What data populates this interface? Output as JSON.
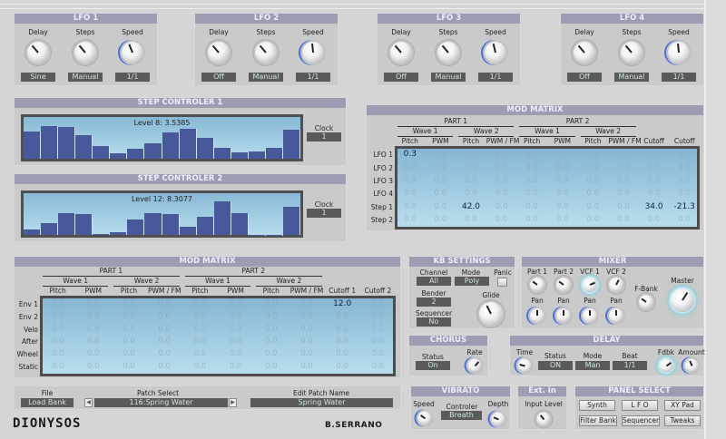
{
  "lfos": [
    {
      "title": "LFO 1",
      "knobs": [
        {
          "label": "Delay",
          "value": 0.35
        },
        {
          "label": "Steps",
          "value": 0.35
        },
        {
          "label": "Speed",
          "value": 0.42,
          "active": true
        }
      ],
      "values": [
        "Sine",
        "Manual",
        "1/1"
      ]
    },
    {
      "title": "LFO 2",
      "knobs": [
        {
          "label": "Delay",
          "value": 0.35
        },
        {
          "label": "Steps",
          "value": 0.35
        },
        {
          "label": "Speed",
          "value": 0.48,
          "active": true
        }
      ],
      "values": [
        "Off",
        "Manual",
        "1/1"
      ]
    },
    {
      "title": "LFO 3",
      "knobs": [
        {
          "label": "Delay",
          "value": 0.35
        },
        {
          "label": "Steps",
          "value": 0.35
        },
        {
          "label": "Speed",
          "value": 0.45,
          "active": true
        }
      ],
      "values": [
        "Off",
        "Manual",
        "1/1"
      ]
    },
    {
      "title": "LFO 4",
      "knobs": [
        {
          "label": "Delay",
          "value": 0.35
        },
        {
          "label": "Steps",
          "value": 0.35
        },
        {
          "label": "Speed",
          "value": 0.48,
          "active": true
        }
      ],
      "values": [
        "Off",
        "Manual",
        "1/1"
      ]
    }
  ],
  "step_controllers": [
    {
      "title": "STEP CONTROLER 1",
      "readout": "Level 8: 3.5385",
      "clock_label": "Clock",
      "clock_value": "1",
      "levels": [
        0.66,
        0.79,
        0.76,
        0.57,
        0.3,
        0.14,
        0.25,
        0.38,
        0.63,
        0.72,
        0.51,
        0.26,
        0.16,
        0.18,
        0.26,
        0.7
      ]
    },
    {
      "title": "STEP CONTROLER 2",
      "readout": "Level 12: 8.3077",
      "clock_label": "Clock",
      "clock_value": "1",
      "levels": [
        0.13,
        0.29,
        0.53,
        0.49,
        0.02,
        0.07,
        0.36,
        0.53,
        0.51,
        0.19,
        0.43,
        0.8,
        0.52,
        0.01,
        0.01,
        0.67
      ]
    }
  ],
  "mod_matrix_lfo": {
    "title": "MOD MATRIX",
    "parts": [
      "PART 1",
      "PART 2"
    ],
    "waves": [
      "Wave 1",
      "Wave 2",
      "Wave 1",
      "Wave 2"
    ],
    "columns": [
      "Pitch",
      "PWM",
      "Pitch",
      "PWM / FM",
      "Pitch",
      "PWM",
      "Pitch",
      "PWM / FM",
      "Cutoff",
      "Cutoff"
    ],
    "rows": [
      {
        "label": "LFO 1",
        "values": [
          "0.3",
          "0.0",
          "0.0",
          "0.0",
          "0.0",
          "0.0",
          "0.0",
          "0.0",
          "0.0",
          "0.0"
        ]
      },
      {
        "label": "LFO 2",
        "values": [
          "0.0",
          "0.0",
          "0.0",
          "0.0",
          "0.0",
          "0.0",
          "0.0",
          "0.0",
          "0.0",
          "0.0"
        ]
      },
      {
        "label": "LFO 3",
        "values": [
          "0.0",
          "0.0",
          "0.0",
          "0.0",
          "0.0",
          "0.0",
          "0.0",
          "0.0",
          "0.0",
          "0.0"
        ]
      },
      {
        "label": "LFO 4",
        "values": [
          "0.0",
          "0.0",
          "0.0",
          "0.0",
          "0.0",
          "0.0",
          "0.0",
          "0.0",
          "0.0",
          "0.0"
        ]
      },
      {
        "label": "Step 1",
        "values": [
          "0.0",
          "0.0",
          "42.0",
          "0.0",
          "0.0",
          "0.0",
          "0.0",
          "0.0",
          "34.0",
          "-21.3"
        ]
      },
      {
        "label": "Step 2",
        "values": [
          "0.0",
          "0.0",
          "0.0",
          "0.0",
          "0.0",
          "0.0",
          "0.0",
          "0.0",
          "0.0",
          "0.0"
        ]
      }
    ]
  },
  "mod_matrix_env": {
    "title": "MOD MATRIX",
    "parts": [
      "PART 1",
      "PART 2"
    ],
    "waves": [
      "Wave 1",
      "Wave 2",
      "Wave 1",
      "Wave 2"
    ],
    "columns": [
      "Pitch",
      "PWM",
      "Pitch",
      "PWM / FM",
      "Pitch",
      "PWM",
      "Pitch",
      "PWM / FM",
      "Cutoff 1",
      "Cutoff 2"
    ],
    "rows": [
      {
        "label": "Env 1",
        "values": [
          "0.0",
          "0.0",
          "0.0",
          "0.0",
          "0.0",
          "0.0",
          "0.0",
          "0.0",
          "12.0",
          "0.0"
        ]
      },
      {
        "label": "Env 2",
        "values": [
          "0.0",
          "0.0",
          "0.0",
          "0.0",
          "0.0",
          "0.0",
          "0.0",
          "0.0",
          "0.0",
          "0.0"
        ]
      },
      {
        "label": "Velo",
        "values": [
          "0.0",
          "0.0",
          "0.0",
          "0.0",
          "0.0",
          "0.0",
          "0.0",
          "0.0",
          "0.0",
          "0.0"
        ]
      },
      {
        "label": "After",
        "values": [
          "0.0",
          "0.0",
          "0.0",
          "0.0",
          "0.0",
          "0.0",
          "0.0",
          "0.0",
          "0.0",
          "0.0"
        ]
      },
      {
        "label": "Wheel",
        "values": [
          "0.0",
          "0.0",
          "0.0",
          "0.0",
          "0.0",
          "0.0",
          "0.0",
          "0.0",
          "0.0",
          "0.0"
        ]
      },
      {
        "label": "Static",
        "values": [
          "0.0",
          "0.0",
          "0.0",
          "0.0",
          "0.0",
          "0.0",
          "0.0",
          "0.0",
          "0.0",
          "0.0"
        ]
      }
    ]
  },
  "kb": {
    "title": "KB SETTINGS",
    "channel_label": "Channel",
    "channel": "All",
    "mode_label": "Mode",
    "mode": "Poly",
    "panic_label": "Panic",
    "bender_label": "Bender",
    "bender": "2",
    "sequencer_label": "Sequencer",
    "sequencer": "No",
    "glide_label": "Glide",
    "glide": 0.4
  },
  "mixer": {
    "title": "MIXER",
    "knobs": [
      {
        "label": "Part 1",
        "value": 0.3
      },
      {
        "label": "Part 2",
        "value": 0.3
      },
      {
        "label": "VCF 1",
        "value": 0.75,
        "glow": true
      },
      {
        "label": "VCF 2",
        "value": 0.6
      }
    ],
    "pans": [
      {
        "label": "Pan",
        "value": 0.5,
        "active": true
      },
      {
        "label": "Pan",
        "value": 0.5,
        "active": true
      },
      {
        "label": "Pan",
        "value": 0.5,
        "active": true
      },
      {
        "label": "Pan",
        "value": 0.5,
        "active": true
      }
    ],
    "fbank_label": "F-Bank",
    "fbank": 0.3,
    "master_label": "Master",
    "master": 0.62
  },
  "chorus": {
    "title": "CHORUS",
    "status_label": "Status",
    "status": "On",
    "rate_label": "Rate",
    "rate": 0.65
  },
  "delay": {
    "title": "DELAY",
    "time_label": "Time",
    "time": 0.22,
    "status_label": "Status",
    "status": "ON",
    "mode_label": "Mode",
    "mode": "Man",
    "beat_label": "Beat",
    "beat": "1/1",
    "fdbk_label": "Fdbk",
    "fdbk": 0.7,
    "amount_label": "Amount",
    "amount": 0.42
  },
  "vibrato": {
    "title": "VIBRATO",
    "speed_label": "Speed",
    "speed": 0.3,
    "controller_label": "Controler",
    "controller": "Breath",
    "depth_label": "Depth",
    "depth": 0.25
  },
  "ext_in": {
    "title": "Ext. in",
    "input_label": "Input Level",
    "input": 0.35
  },
  "panel_select": {
    "title": "PANEL SELECT",
    "buttons": [
      "Synth",
      "L F O",
      "XY Pad",
      "Filter Bank",
      "Sequencer",
      "Tweaks"
    ]
  },
  "file_bar": {
    "file_label": "File",
    "file": "Load Bank",
    "patch_label": "Patch Select",
    "patch": "116:Spring Water",
    "prev": "◀",
    "next": "▶",
    "name_label": "Edit Patch Name",
    "name": "Spring Water"
  },
  "logos": {
    "product": "DIONYSOS",
    "author": "B.SERRANO"
  },
  "colors": {
    "header": "#9c9cb3",
    "bars": "#47599a",
    "display": "#9fcbe2",
    "value_box": "#5a5a5a",
    "knob_ring": "#4a6fe0"
  }
}
